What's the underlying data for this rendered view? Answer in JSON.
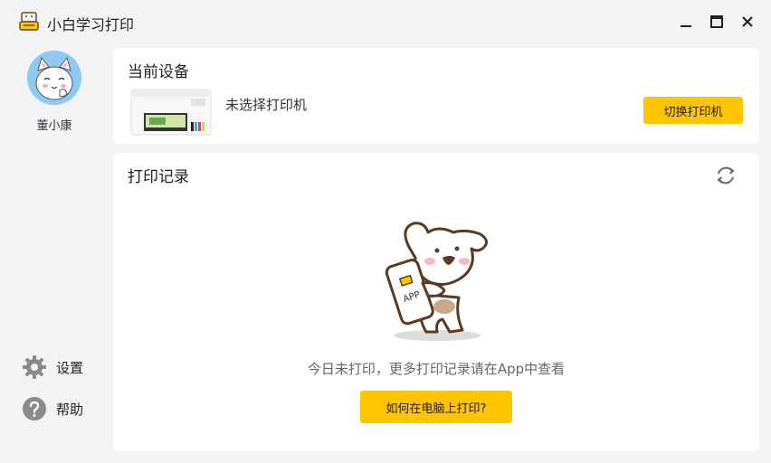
{
  "app": {
    "title": "小白学习打印"
  },
  "user": {
    "name": "董小康"
  },
  "sidebar": {
    "items": [
      {
        "label": "设置",
        "icon": "gear-icon"
      },
      {
        "label": "帮助",
        "icon": "help-icon"
      }
    ]
  },
  "device": {
    "title": "当前设备",
    "status": "未选择打印机",
    "switch_label": "切换打印机"
  },
  "records": {
    "title": "打印记录",
    "empty_text": "今日未打印，更多打印记录请在App中查看",
    "help_label": "如何在电脑上打印?",
    "phone_text": "APP"
  },
  "colors": {
    "accent": "#ffc400",
    "background": "#f2f3f5"
  }
}
